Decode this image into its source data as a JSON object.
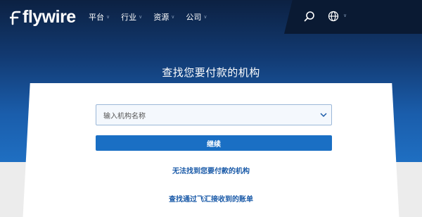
{
  "header": {
    "logo_text": "flywire",
    "nav": [
      {
        "label": "平台"
      },
      {
        "label": "行业"
      },
      {
        "label": "资源"
      },
      {
        "label": "公司"
      }
    ]
  },
  "main": {
    "title": "查找您要付款的机构",
    "institution_select": {
      "placeholder": "输入机构名称"
    },
    "continue_label": "继续",
    "cant_find_link": "无法找到您要付款的机构",
    "find_bill_link": "查找通过飞汇接收到的账单"
  },
  "colors": {
    "brand_blue": "#1a6fc4",
    "link_blue": "#1a5aa8",
    "header_dark": "#0a1a33"
  }
}
